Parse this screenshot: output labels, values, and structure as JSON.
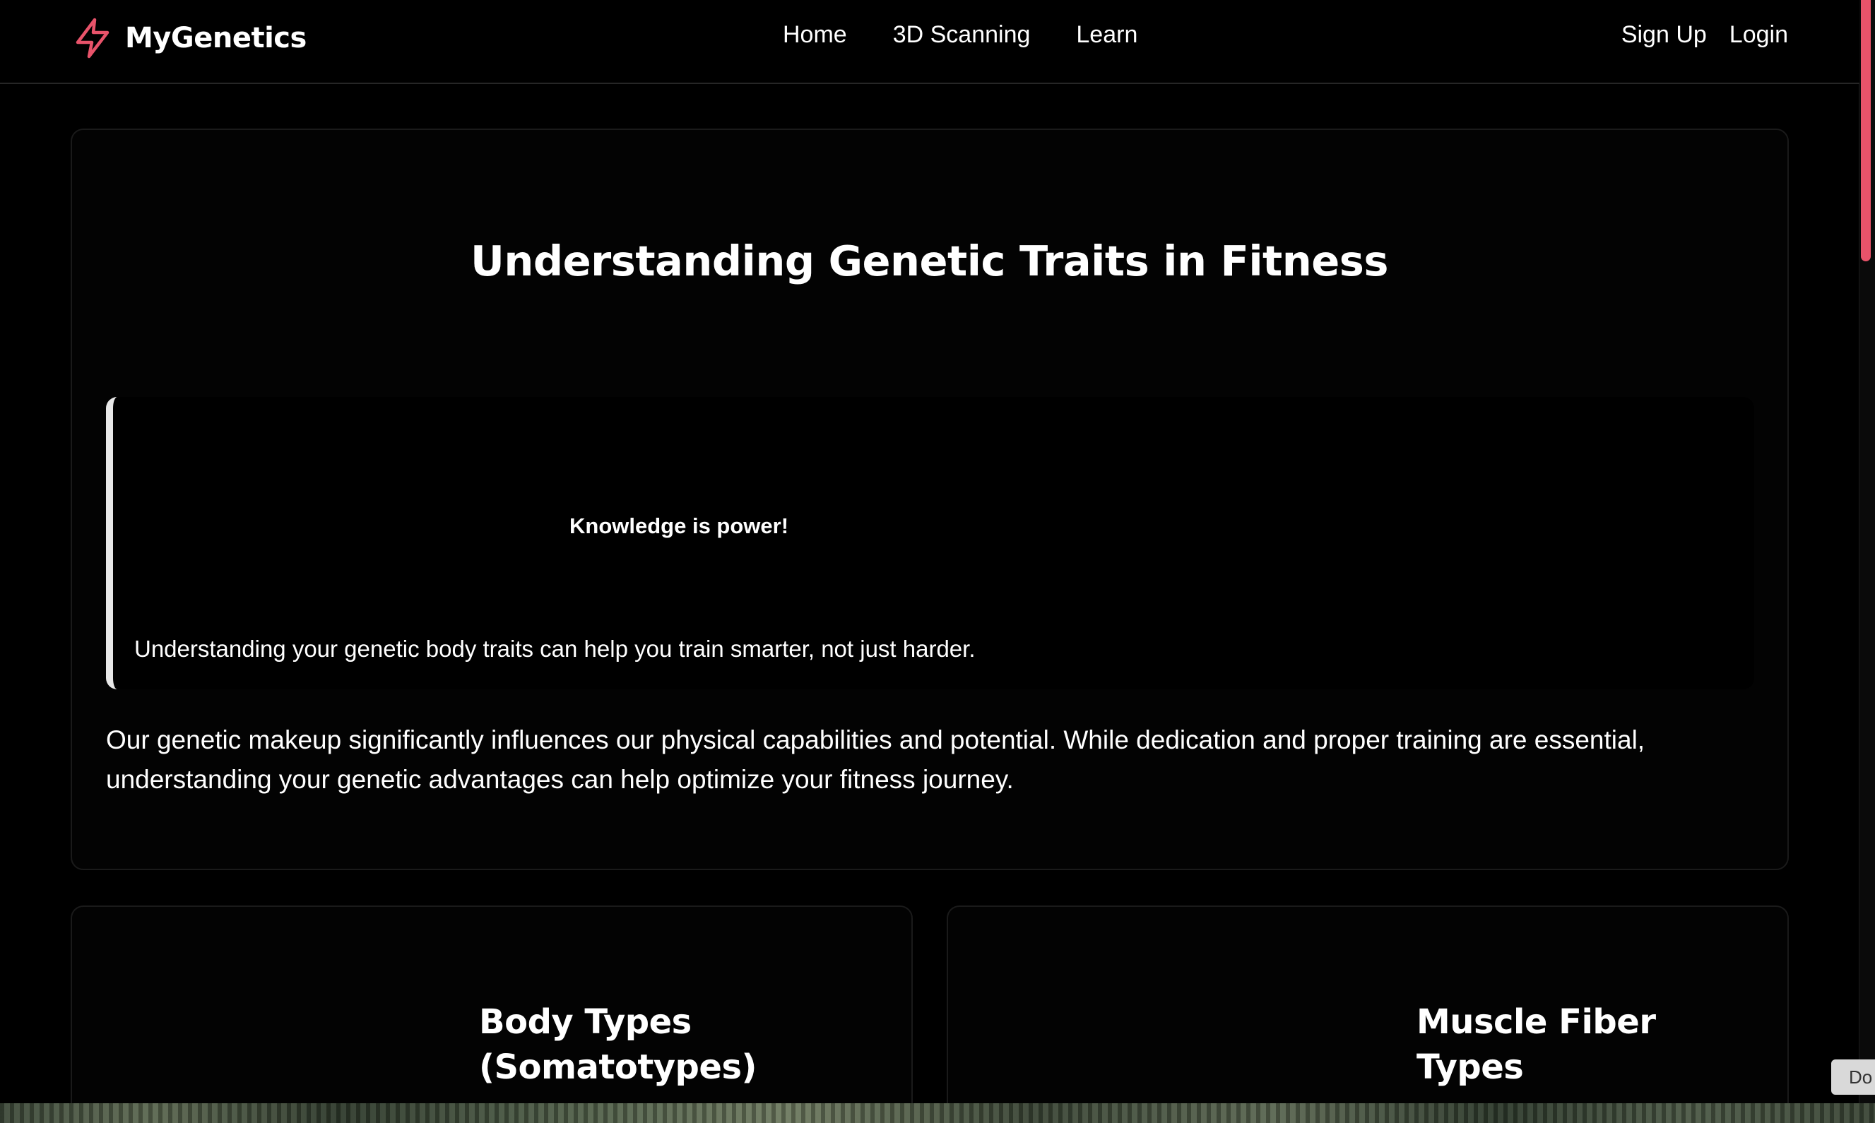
{
  "brand": {
    "name": "MyGenetics",
    "icon": "lightning-bolt-icon",
    "accent_color": "#e8536a"
  },
  "nav": {
    "items": [
      {
        "label": "Home"
      },
      {
        "label": "3D Scanning"
      },
      {
        "label": "Learn"
      }
    ]
  },
  "auth": {
    "signup_label": "Sign Up",
    "login_label": "Login"
  },
  "hero": {
    "title": "Understanding Genetic Traits in Fitness",
    "quote_heading": "Knowledge is power!",
    "quote_text": "Understanding your genetic body traits can help you train smarter, not just harder.",
    "paragraph": "Our genetic makeup significantly influences our physical capabilities and potential. While dedication and proper training are essential, understanding your genetic advantages can help optimize your fitness journey."
  },
  "sections": {
    "body_types_title": "Body Types (Somatotypes)",
    "muscle_fiber_title": "Muscle Fiber Types"
  },
  "corner_tab": {
    "label": "Do"
  },
  "colors": {
    "background": "#000000",
    "text": "#ffffff",
    "quote_border": "#e8e8e8",
    "card_border": "#1a1a1a"
  }
}
